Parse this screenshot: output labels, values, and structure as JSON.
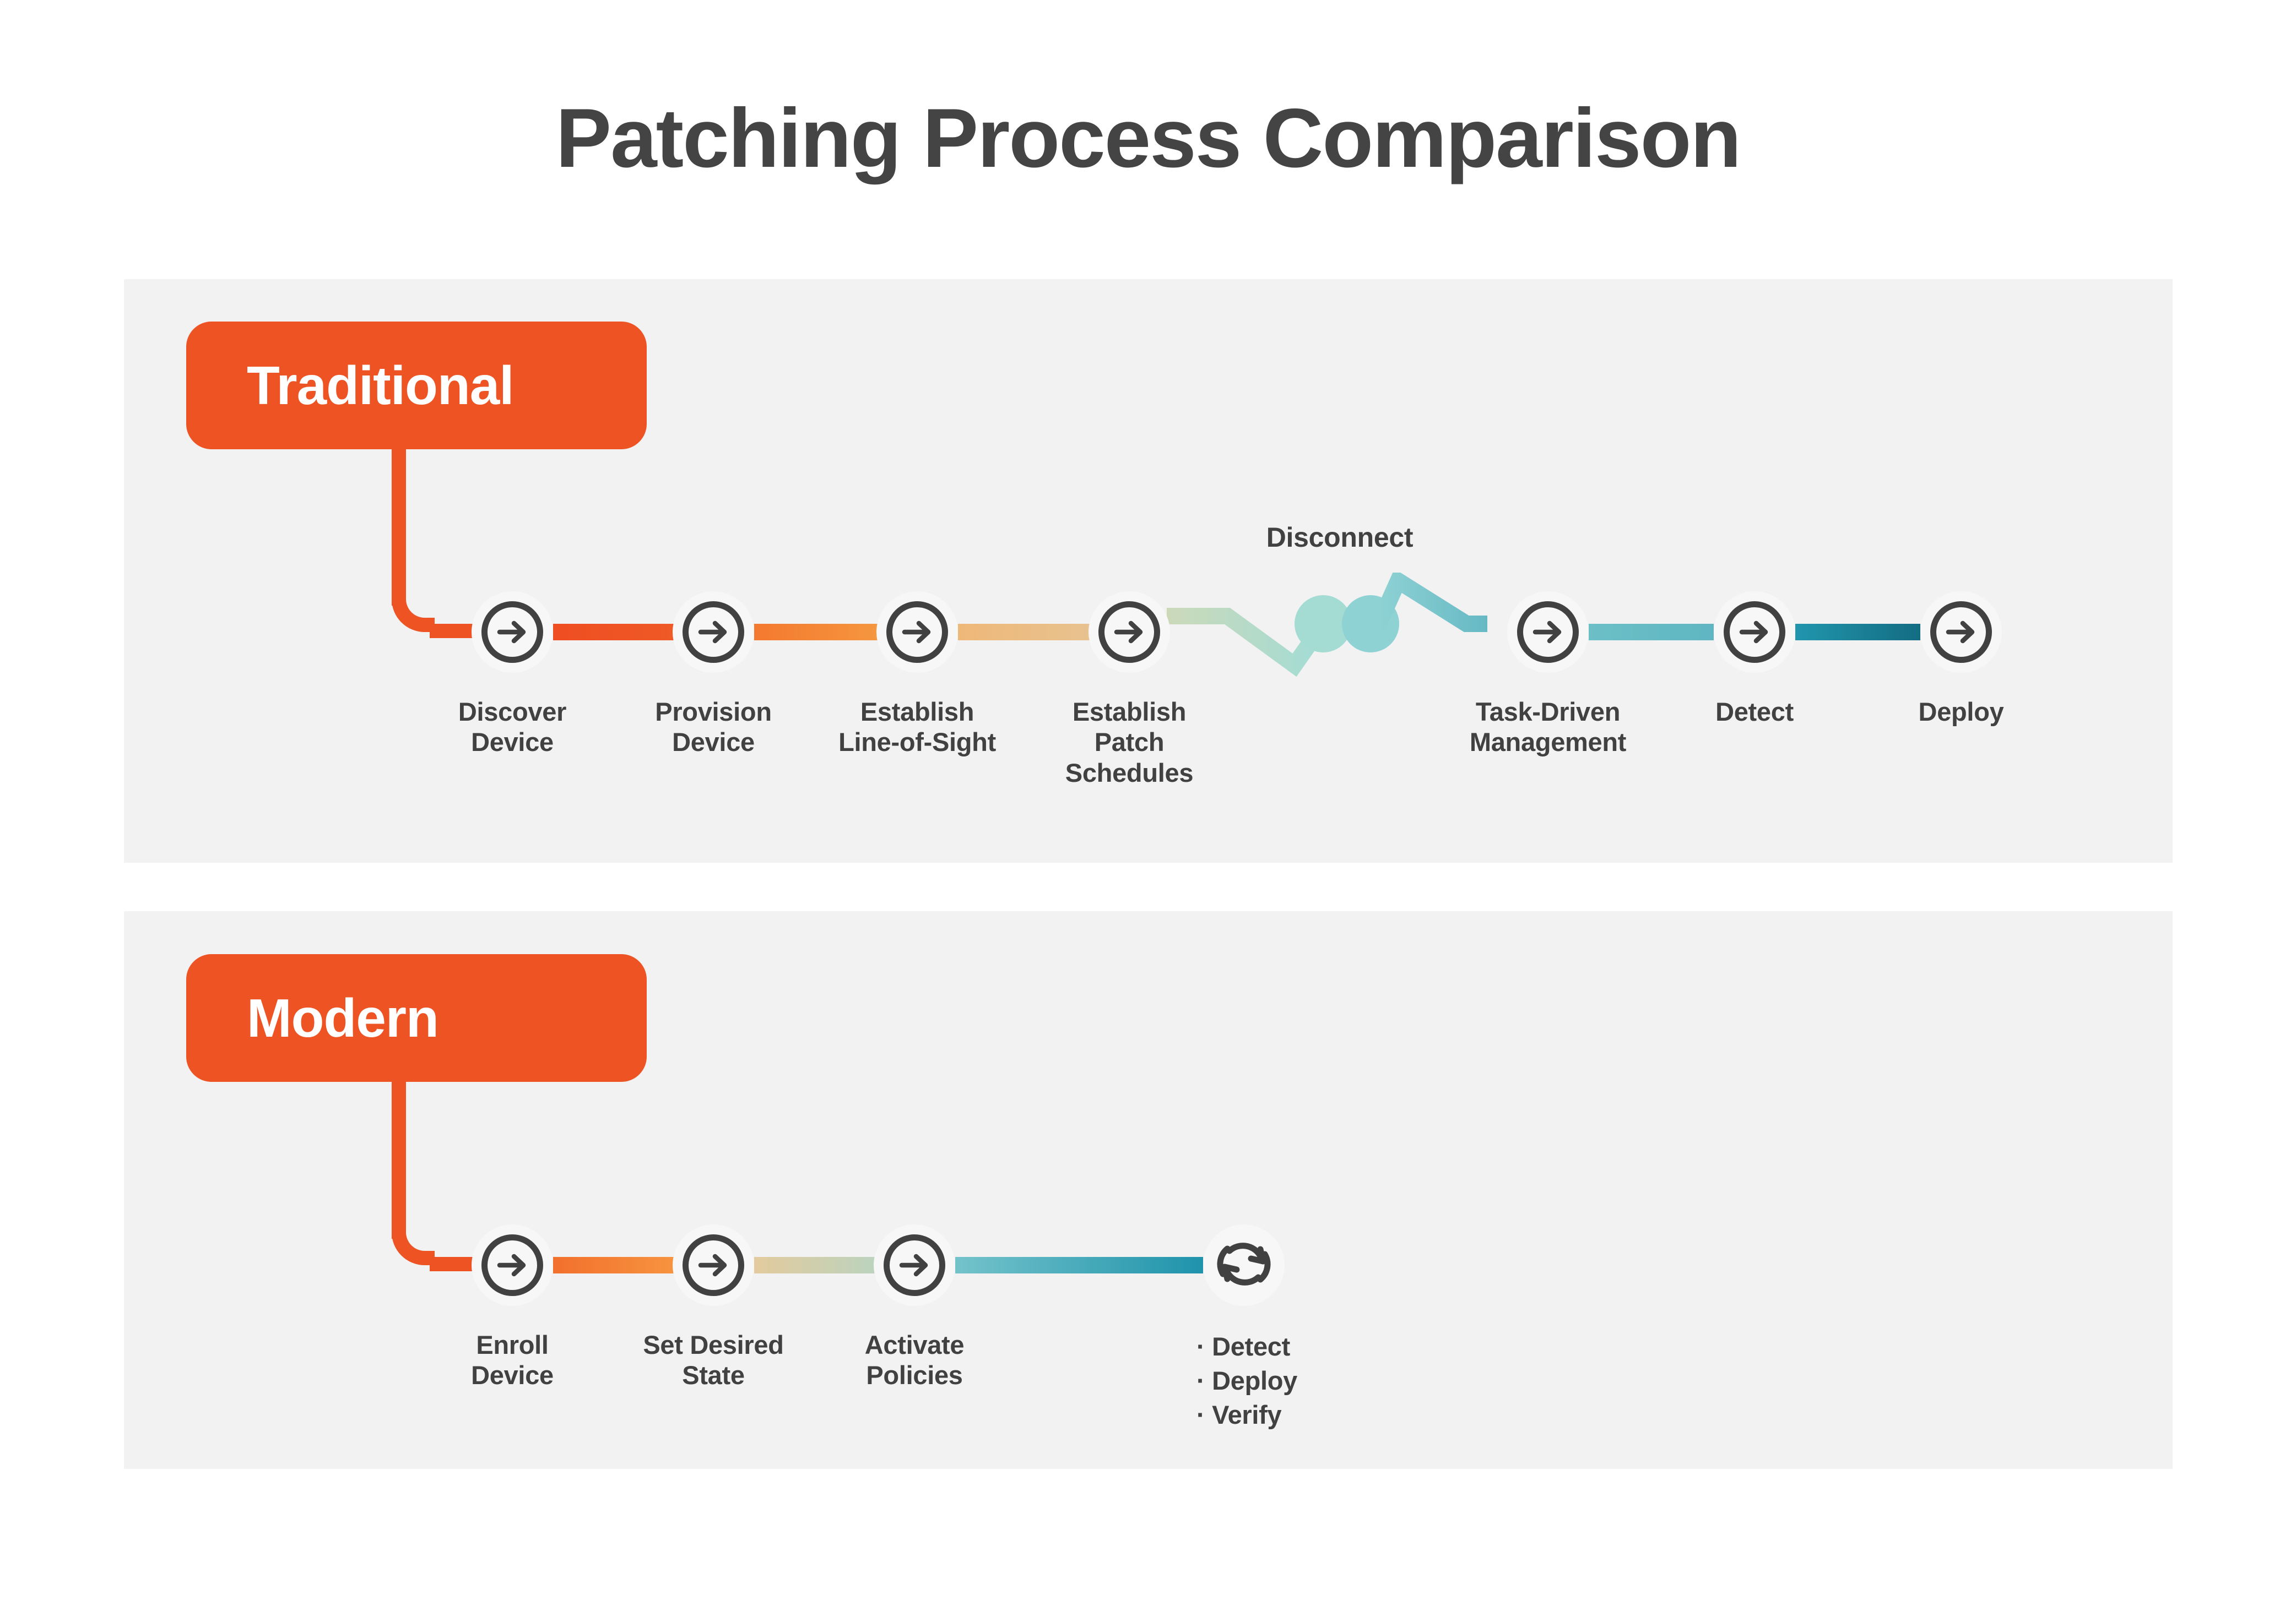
{
  "page": {
    "title": "Patching Process Comparison",
    "background": "#ffffff",
    "panel_bg": "#f2f2f2",
    "accent_orange": "#ee5323",
    "text_dark": "#414141",
    "title_color": "#444444"
  },
  "rows": [
    {
      "badge": "Traditional",
      "disconnect_label": "Disconnect",
      "steps": [
        {
          "label_lines": [
            "Discover",
            "Device"
          ],
          "icon": "arrow-right-icon"
        },
        {
          "label_lines": [
            "Provision",
            "Device"
          ],
          "icon": "arrow-right-icon"
        },
        {
          "label_lines": [
            "Establish",
            "Line-of-Sight"
          ],
          "icon": "arrow-right-icon"
        },
        {
          "label_lines": [
            "Establish",
            "Patch",
            "Schedules"
          ],
          "icon": "arrow-right-icon"
        },
        {
          "label_lines": [
            "Task-Driven",
            "Management"
          ],
          "icon": "arrow-right-icon"
        },
        {
          "label_lines": [
            "Detect"
          ],
          "icon": "arrow-right-icon"
        },
        {
          "label_lines": [
            "Deploy"
          ],
          "icon": "arrow-right-icon"
        }
      ],
      "segment_colors": [
        [
          "#ef4d22",
          "#ef5a26"
        ],
        [
          "#f4792f",
          "#f59640"
        ],
        [
          "#eeb878",
          "#e8c28f"
        ],
        [
          "#c9dcc0",
          "#a9dbd2"
        ],
        [
          "#6cbfc6",
          "#64b9c3"
        ],
        [
          "#2196ad",
          "#136c82"
        ]
      ],
      "disconnect_colors": {
        "left_start": "#ccd9b9",
        "left_end": "#a4dcd4",
        "right_start": "#8fd2d4",
        "right_end": "#66b9c4"
      }
    },
    {
      "badge": "Modern",
      "steps": [
        {
          "label_lines": [
            "Enroll",
            "Device"
          ],
          "icon": "arrow-right-icon"
        },
        {
          "label_lines": [
            "Set Desired",
            "State"
          ],
          "icon": "arrow-right-icon"
        },
        {
          "label_lines": [
            "Activate",
            "Policies"
          ],
          "icon": "arrow-right-icon"
        }
      ],
      "cycle": {
        "icon": "refresh-cycle-icon",
        "bullets": [
          "· Detect",
          "· Deploy",
          "· Verify"
        ]
      },
      "segment_colors": [
        [
          "#f2702c",
          "#f79340"
        ],
        [
          "#e3cb9d",
          "#bcd3be"
        ],
        [
          "#74c3cb",
          "#1f93ab"
        ]
      ]
    }
  ]
}
